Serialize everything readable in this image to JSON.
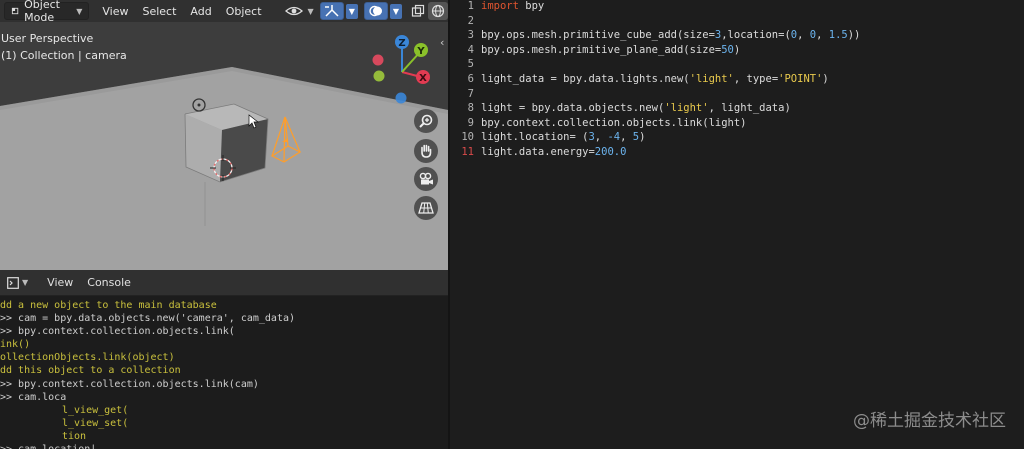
{
  "viewport": {
    "mode_label": "Object Mode",
    "menu": [
      "View",
      "Select",
      "Add",
      "Object"
    ],
    "overlay_line1": "User Perspective",
    "overlay_line2": "(1) Collection | camera",
    "gizmo_labels": {
      "z": "Z",
      "y": "Y",
      "x": "X"
    },
    "colors": {
      "x": "#e23b52",
      "y": "#8ac12a",
      "z": "#3a86d8",
      "camera_outline": "#ff9e2a",
      "header": "#303030"
    }
  },
  "console": {
    "menu": [
      "View",
      "Console"
    ],
    "lines": [
      {
        "kind": "out",
        "text": "dd a new object to the main database"
      },
      {
        "kind": "in",
        "text": ">> cam = bpy.data.objects.new('camera', cam_data)"
      },
      {
        "kind": "in",
        "text": ">> bpy.context.collection.objects.link("
      },
      {
        "kind": "out",
        "text": "ink()"
      },
      {
        "kind": "out",
        "text": "ollectionObjects.link(object)"
      },
      {
        "kind": "out",
        "text": "dd this object to a collection"
      },
      {
        "kind": "in",
        "text": ">> bpy.context.collection.objects.link(cam)"
      },
      {
        "kind": "in",
        "text": ">> cam.loca"
      },
      {
        "kind": "cmp",
        "text": "l_view_get("
      },
      {
        "kind": "cmp",
        "text": "l_view_set("
      },
      {
        "kind": "cmp",
        "text": "tion"
      },
      {
        "kind": "in",
        "text": ">> cam.location|"
      }
    ]
  },
  "editor": {
    "lines": [
      {
        "n": "1",
        "err": false,
        "tokens": [
          [
            "kw",
            "import"
          ],
          [
            "t",
            " bpy"
          ]
        ]
      },
      {
        "n": "2",
        "err": false,
        "tokens": []
      },
      {
        "n": "3",
        "err": false,
        "tokens": [
          [
            "t",
            "bpy.ops.mesh.primitive_cube_add(size="
          ],
          [
            "num",
            "3"
          ],
          [
            "t",
            ",location=("
          ],
          [
            "num",
            "0"
          ],
          [
            "t",
            ", "
          ],
          [
            "num",
            "0"
          ],
          [
            "t",
            ", "
          ],
          [
            "num",
            "1.5"
          ],
          [
            "t",
            "))"
          ]
        ]
      },
      {
        "n": "4",
        "err": false,
        "tokens": [
          [
            "t",
            "bpy.ops.mesh.primitive_plane_add(size="
          ],
          [
            "num",
            "50"
          ],
          [
            "t",
            ")"
          ]
        ]
      },
      {
        "n": "5",
        "err": false,
        "tokens": []
      },
      {
        "n": "6",
        "err": false,
        "tokens": [
          [
            "t",
            "light_data = bpy.data.lights.new("
          ],
          [
            "str",
            "'light'"
          ],
          [
            "t",
            ", type="
          ],
          [
            "str",
            "'POINT'"
          ],
          [
            "t",
            ")"
          ]
        ]
      },
      {
        "n": "7",
        "err": false,
        "tokens": []
      },
      {
        "n": "8",
        "err": false,
        "tokens": [
          [
            "t",
            "light = bpy.data.objects.new("
          ],
          [
            "str",
            "'light'"
          ],
          [
            "t",
            ", light_data)"
          ]
        ]
      },
      {
        "n": "9",
        "err": false,
        "tokens": [
          [
            "t",
            "bpy.context.collection.objects.link(light)"
          ]
        ]
      },
      {
        "n": "10",
        "err": false,
        "tokens": [
          [
            "t",
            "light.location= ("
          ],
          [
            "num",
            "3"
          ],
          [
            "t",
            ", "
          ],
          [
            "num",
            "-4"
          ],
          [
            "t",
            ", "
          ],
          [
            "num",
            "5"
          ],
          [
            "t",
            ")"
          ]
        ]
      },
      {
        "n": "11",
        "err": true,
        "tokens": [
          [
            "t",
            "light.data.energy="
          ],
          [
            "num",
            "200.0"
          ]
        ]
      }
    ]
  },
  "watermark": "@稀土掘金技术社区"
}
